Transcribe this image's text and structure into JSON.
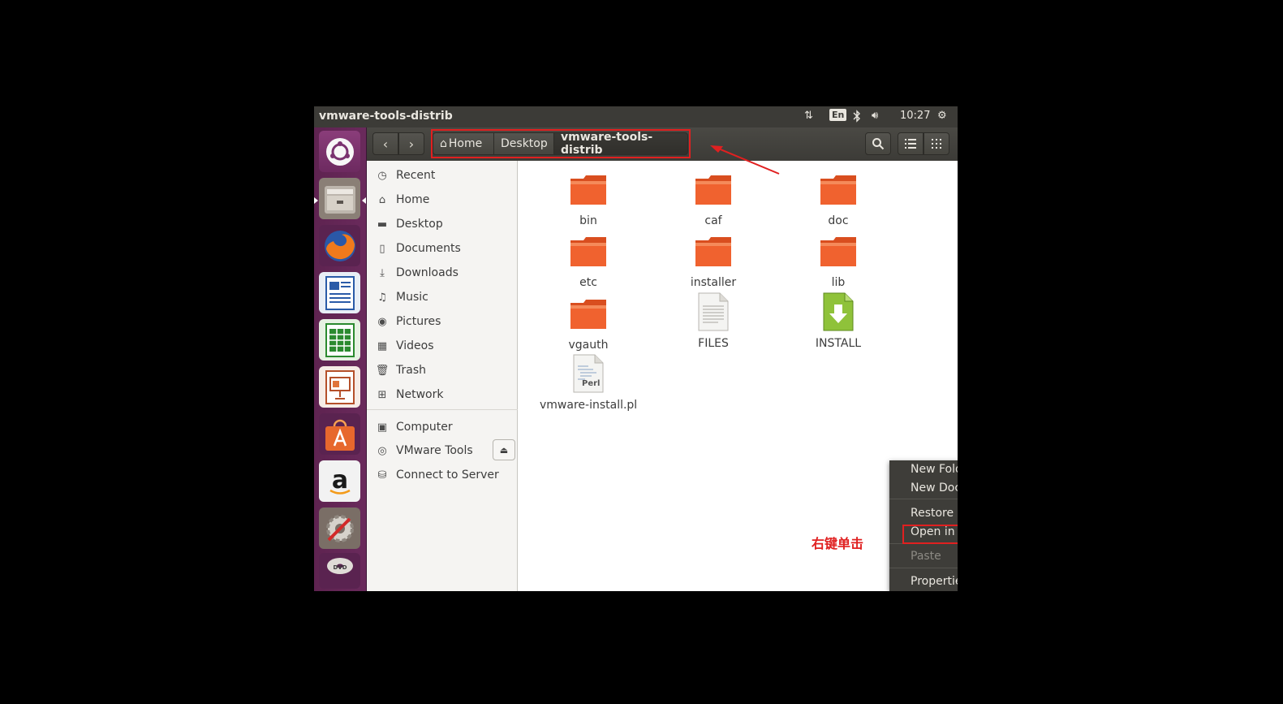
{
  "window_title": "vmware-tools-distrib",
  "top_panel": {
    "lang": "En",
    "time": "10:27",
    "icons": [
      "network-arrows-icon",
      "bluetooth-icon",
      "volume-icon",
      "gear-icon"
    ]
  },
  "launcher": {
    "items": [
      "ubuntu-dash-icon",
      "files-icon",
      "firefox-icon",
      "writer-icon",
      "calc-icon",
      "impress-icon",
      "software-center-icon",
      "amazon-icon",
      "system-settings-icon",
      "dvd-icon"
    ]
  },
  "breadcrumb": {
    "home": "Home",
    "desktop": "Desktop",
    "current": "vmware-tools-distrib"
  },
  "sidebar": {
    "places": [
      {
        "label": "Recent",
        "icon": "clock-icon"
      },
      {
        "label": "Home",
        "icon": "home-icon"
      },
      {
        "label": "Desktop",
        "icon": "folder-icon"
      },
      {
        "label": "Documents",
        "icon": "document-icon"
      },
      {
        "label": "Downloads",
        "icon": "download-icon"
      },
      {
        "label": "Music",
        "icon": "music-icon"
      },
      {
        "label": "Pictures",
        "icon": "camera-icon"
      },
      {
        "label": "Videos",
        "icon": "video-icon"
      },
      {
        "label": "Trash",
        "icon": "trash-icon"
      },
      {
        "label": "Network",
        "icon": "network-icon"
      }
    ],
    "devices": [
      {
        "label": "Computer",
        "icon": "computer-icon"
      },
      {
        "label": "VMware Tools",
        "icon": "disc-icon"
      },
      {
        "label": "Connect to Server",
        "icon": "server-icon"
      }
    ]
  },
  "files": [
    {
      "name": "bin",
      "type": "folder"
    },
    {
      "name": "caf",
      "type": "folder"
    },
    {
      "name": "doc",
      "type": "folder"
    },
    {
      "name": "etc",
      "type": "folder"
    },
    {
      "name": "installer",
      "type": "folder"
    },
    {
      "name": "lib",
      "type": "folder"
    },
    {
      "name": "vgauth",
      "type": "folder"
    },
    {
      "name": "FILES",
      "type": "text"
    },
    {
      "name": "INSTALL",
      "type": "install"
    },
    {
      "name": "vmware-install.pl",
      "type": "perl"
    }
  ],
  "perl_badge": "Perl",
  "context_menu": {
    "new_folder": "New Folder",
    "new_document": "New Document",
    "restore": "Restore Missing Files…",
    "open_terminal": "Open in Terminal",
    "paste": "Paste",
    "properties": "Properties"
  },
  "annotation": "右键单击",
  "colors": {
    "highlight": "#e02020",
    "folder": "#f0622f",
    "panel": "#3c3b37"
  }
}
